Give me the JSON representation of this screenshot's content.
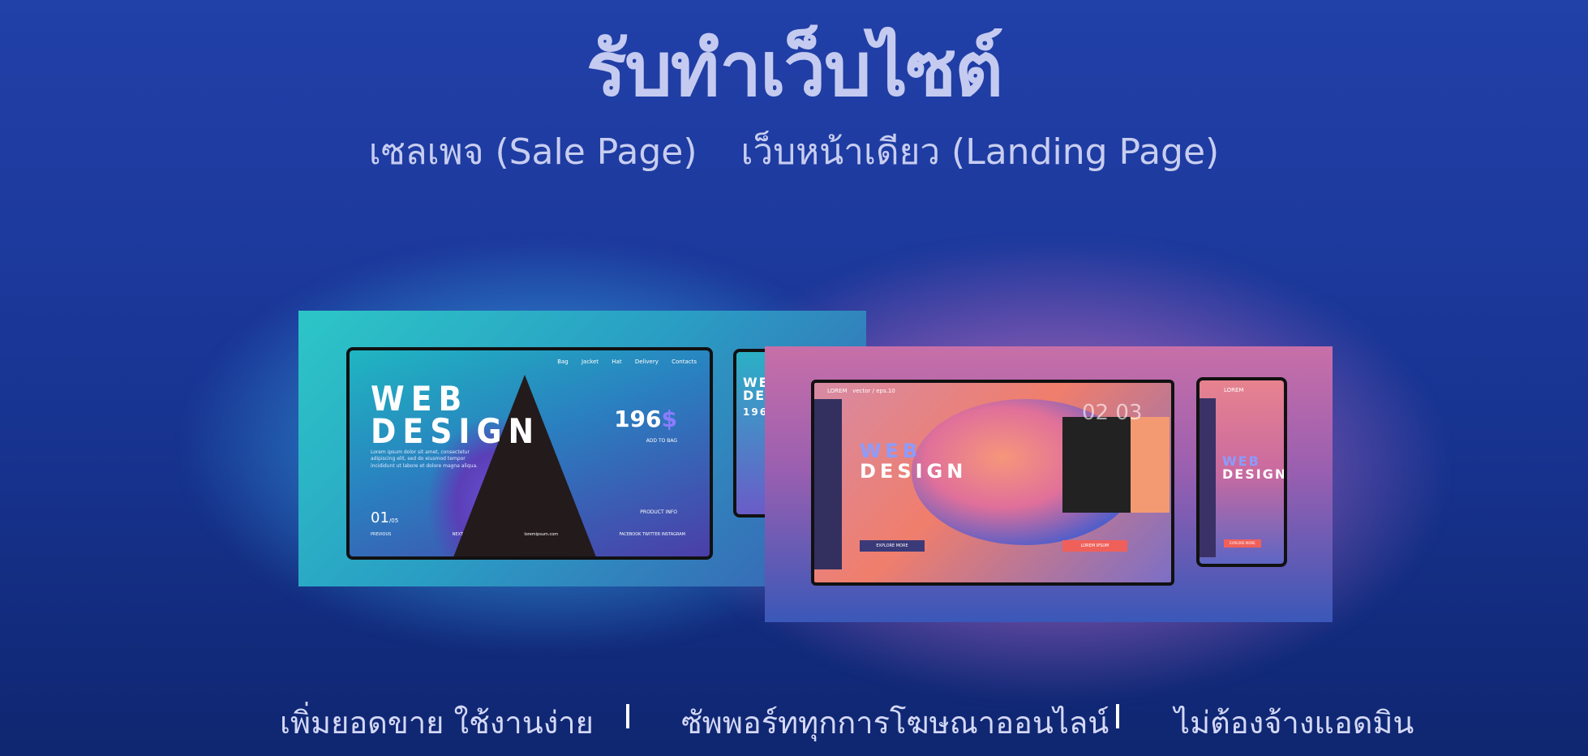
{
  "header": {
    "title": "รับทำเว็บไซต์",
    "subtitle_left": "เซลเพจ (Sale Page)",
    "subtitle_right": "เว็บหน้าเดียว (Landing Page)"
  },
  "mockup_left": {
    "laptop": {
      "headline_1": "WEB",
      "headline_2": "DESIGN",
      "nav": [
        "Bag",
        "Jacket",
        "Hat",
        "Delivery",
        "Contacts"
      ],
      "price": "196",
      "price_currency": "$",
      "add_to_bag": "ADD TO BAG",
      "body": "Lorem ipsum dolor sit amet, consectetur adipiscing elit, sed do eiusmod tempor incididunt ut labore et dolore magna aliqua.",
      "page_number": "01",
      "page_total": "/05",
      "product_info": "PRODUCT INFO",
      "footer": [
        "PREVIOUS",
        "NEXT",
        "loremipsum.com",
        "FACEBOOK TWITTER INSTAGRAM"
      ]
    },
    "phone": {
      "headline_1": "WE",
      "headline_2": "DE",
      "price": "196"
    }
  },
  "mockup_right": {
    "laptop": {
      "brand": "LOREM",
      "tagline": "vector / eps.10",
      "headline_1": "WEB",
      "headline_2": "DESIGN",
      "numbers": "02  03",
      "button_left": "EXPLORE MORE",
      "button_right": "LOREM IPSUM",
      "caption": "LOREM IPSUM"
    },
    "phone": {
      "brand": "LOREM",
      "headline_1": "WEB",
      "headline_2": "DESIGN",
      "button": "EXPLORE MORE"
    }
  },
  "taglines": {
    "item_1": "เพิ่มยอดขาย ใช้งานง่าย",
    "separator": "I",
    "item_2": "ซัพพอร์ททุกการโฆษณาออนไลน์",
    "item_3": "ไม่ต้องจ้างแอดมิน"
  },
  "colors": {
    "background_top": "#2140a8",
    "background_bottom": "#0f2670",
    "text": "#c9cff0",
    "glow_cyan": "#50dcff",
    "glow_pink": "#f08cd2"
  }
}
